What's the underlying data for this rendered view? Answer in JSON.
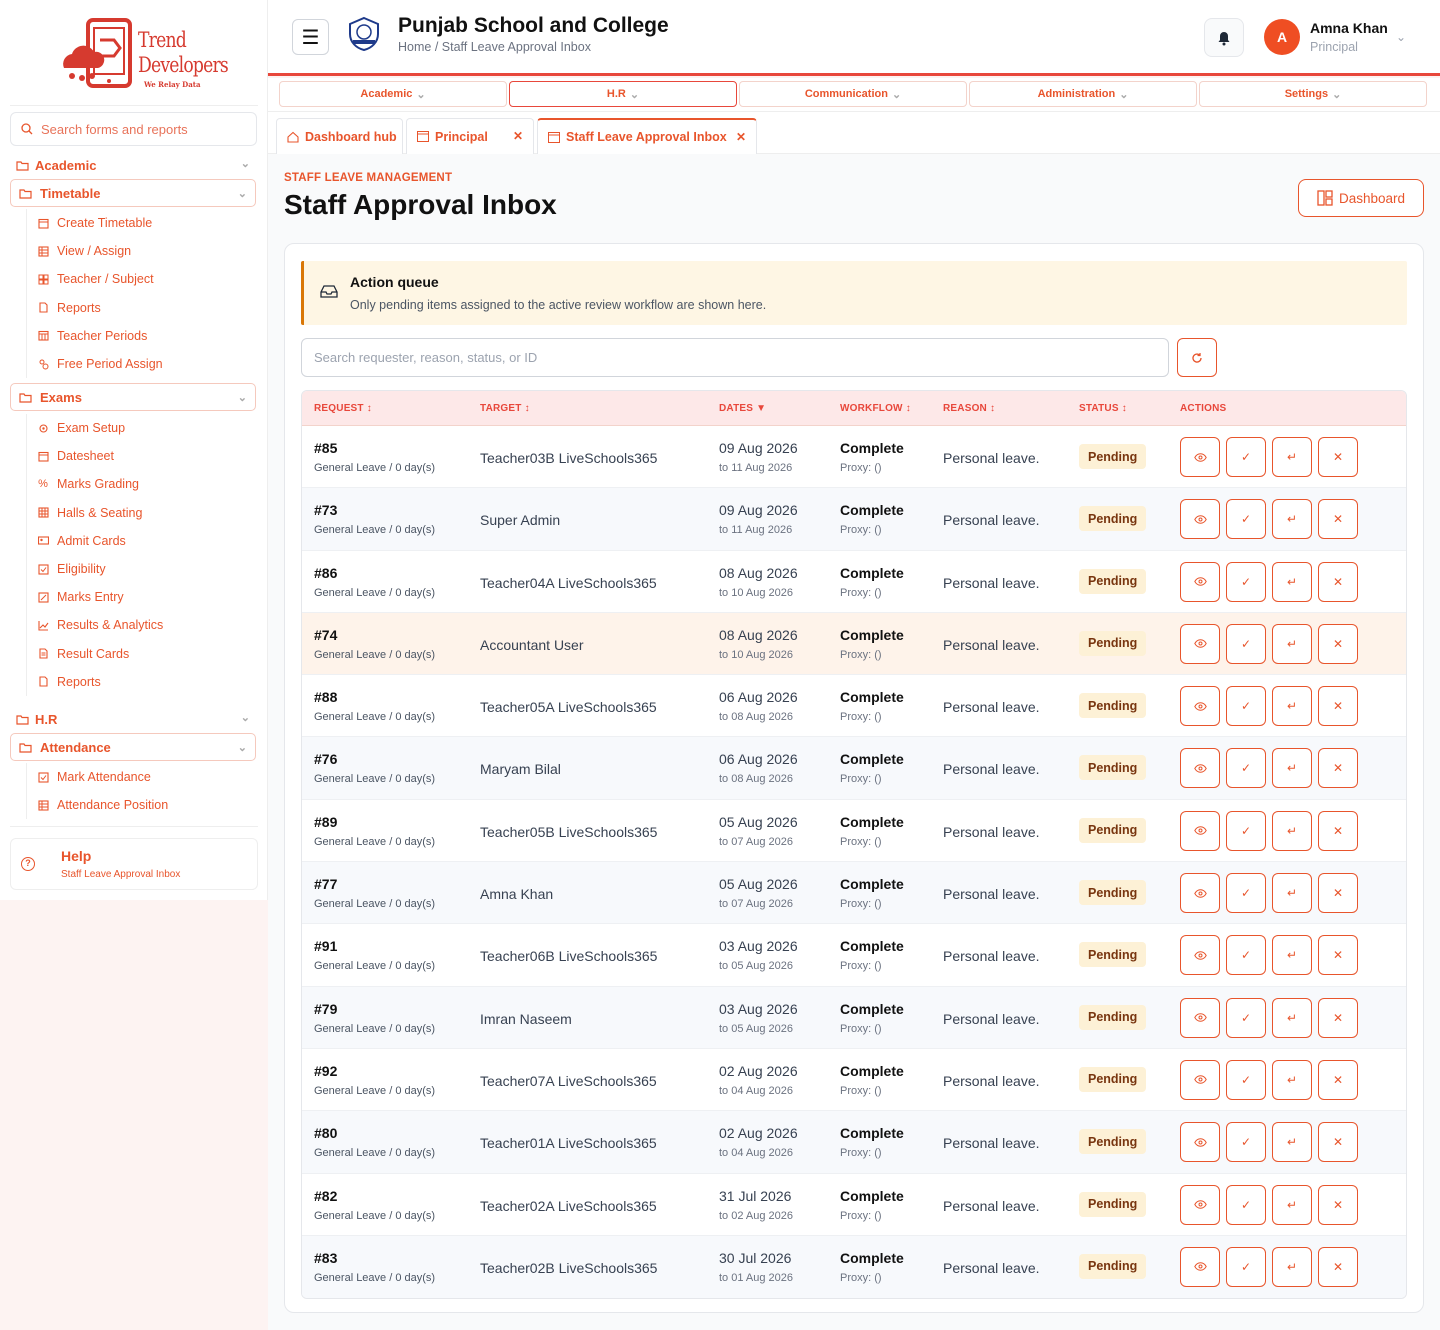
{
  "brand": {
    "line1": "Trend",
    "line2": "Developers",
    "tagline": "We Relay Data"
  },
  "sidebar": {
    "search_placeholder": "Search forms and reports",
    "academic": "Academic",
    "timetable": {
      "label": "Timetable",
      "items": [
        "Create Timetable",
        "View / Assign",
        "Teacher / Subject",
        "Reports",
        "Teacher Periods",
        "Free Period Assign"
      ]
    },
    "exams": {
      "label": "Exams",
      "items": [
        "Exam Setup",
        "Datesheet",
        "Marks Grading",
        "Halls & Seating",
        "Admit Cards",
        "Eligibility",
        "Marks Entry",
        "Results & Analytics",
        "Result Cards",
        "Reports"
      ]
    },
    "hr": "H.R",
    "attendance": {
      "label": "Attendance",
      "items": [
        "Mark Attendance",
        "Attendance Position"
      ]
    },
    "help": {
      "title": "Help",
      "subtitle": "Staff Leave Approval Inbox"
    }
  },
  "header": {
    "school_name": "Punjab School and College",
    "breadcrumb": "Home / Staff Leave Approval Inbox",
    "user": {
      "initial": "A",
      "name": "Amna Khan",
      "role": "Principal"
    }
  },
  "topnav": [
    "Academic",
    "H.R",
    "Communication",
    "Administration",
    "Settings"
  ],
  "tabs": [
    {
      "label": "Dashboard hub"
    },
    {
      "label": "Principal"
    },
    {
      "label": "Staff Leave Approval Inbox"
    }
  ],
  "main": {
    "eyebrow": "STAFF LEAVE MANAGEMENT",
    "title": "Staff Approval Inbox",
    "dashboard_label": "Dashboard",
    "alert": {
      "title": "Action queue",
      "text": "Only pending items assigned to the active review workflow are shown here."
    },
    "search_placeholder": "Search requester, reason, status, or ID"
  },
  "table": {
    "headers": {
      "request": "REQUEST",
      "target": "TARGET",
      "dates": "DATES",
      "workflow": "WORKFLOW",
      "reason": "REASON",
      "status": "STATUS",
      "actions": "ACTIONS"
    },
    "rows": [
      {
        "id": "#85",
        "type": "General Leave / 0 day(s)",
        "target": "Teacher03B LiveSchools365",
        "from": "09 Aug 2026",
        "to": "to 11 Aug 2026",
        "workflow": "Complete",
        "proxy": "Proxy: ()",
        "reason": "Personal leave.",
        "status": "Pending"
      },
      {
        "id": "#73",
        "type": "General Leave / 0 day(s)",
        "target": "Super Admin",
        "from": "09 Aug 2026",
        "to": "to 11 Aug 2026",
        "workflow": "Complete",
        "proxy": "Proxy: ()",
        "reason": "Personal leave.",
        "status": "Pending"
      },
      {
        "id": "#86",
        "type": "General Leave / 0 day(s)",
        "target": "Teacher04A LiveSchools365",
        "from": "08 Aug 2026",
        "to": "to 10 Aug 2026",
        "workflow": "Complete",
        "proxy": "Proxy: ()",
        "reason": "Personal leave.",
        "status": "Pending"
      },
      {
        "id": "#74",
        "type": "General Leave / 0 day(s)",
        "target": "Accountant User",
        "from": "08 Aug 2026",
        "to": "to 10 Aug 2026",
        "workflow": "Complete",
        "proxy": "Proxy: ()",
        "reason": "Personal leave.",
        "status": "Pending"
      },
      {
        "id": "#88",
        "type": "General Leave / 0 day(s)",
        "target": "Teacher05A LiveSchools365",
        "from": "06 Aug 2026",
        "to": "to 08 Aug 2026",
        "workflow": "Complete",
        "proxy": "Proxy: ()",
        "reason": "Personal leave.",
        "status": "Pending"
      },
      {
        "id": "#76",
        "type": "General Leave / 0 day(s)",
        "target": "Maryam Bilal",
        "from": "06 Aug 2026",
        "to": "to 08 Aug 2026",
        "workflow": "Complete",
        "proxy": "Proxy: ()",
        "reason": "Personal leave.",
        "status": "Pending"
      },
      {
        "id": "#89",
        "type": "General Leave / 0 day(s)",
        "target": "Teacher05B LiveSchools365",
        "from": "05 Aug 2026",
        "to": "to 07 Aug 2026",
        "workflow": "Complete",
        "proxy": "Proxy: ()",
        "reason": "Personal leave.",
        "status": "Pending"
      },
      {
        "id": "#77",
        "type": "General Leave / 0 day(s)",
        "target": "Amna Khan",
        "from": "05 Aug 2026",
        "to": "to 07 Aug 2026",
        "workflow": "Complete",
        "proxy": "Proxy: ()",
        "reason": "Personal leave.",
        "status": "Pending"
      },
      {
        "id": "#91",
        "type": "General Leave / 0 day(s)",
        "target": "Teacher06B LiveSchools365",
        "from": "03 Aug 2026",
        "to": "to 05 Aug 2026",
        "workflow": "Complete",
        "proxy": "Proxy: ()",
        "reason": "Personal leave.",
        "status": "Pending"
      },
      {
        "id": "#79",
        "type": "General Leave / 0 day(s)",
        "target": "Imran Naseem",
        "from": "03 Aug 2026",
        "to": "to 05 Aug 2026",
        "workflow": "Complete",
        "proxy": "Proxy: ()",
        "reason": "Personal leave.",
        "status": "Pending"
      },
      {
        "id": "#92",
        "type": "General Leave / 0 day(s)",
        "target": "Teacher07A LiveSchools365",
        "from": "02 Aug 2026",
        "to": "to 04 Aug 2026",
        "workflow": "Complete",
        "proxy": "Proxy: ()",
        "reason": "Personal leave.",
        "status": "Pending"
      },
      {
        "id": "#80",
        "type": "General Leave / 0 day(s)",
        "target": "Teacher01A LiveSchools365",
        "from": "02 Aug 2026",
        "to": "to 04 Aug 2026",
        "workflow": "Complete",
        "proxy": "Proxy: ()",
        "reason": "Personal leave.",
        "status": "Pending"
      },
      {
        "id": "#82",
        "type": "General Leave / 0 day(s)",
        "target": "Teacher02A LiveSchools365",
        "from": "31 Jul 2026",
        "to": "to 02 Aug 2026",
        "workflow": "Complete",
        "proxy": "Proxy: ()",
        "reason": "Personal leave.",
        "status": "Pending"
      },
      {
        "id": "#83",
        "type": "General Leave / 0 day(s)",
        "target": "Teacher02B LiveSchools365",
        "from": "30 Jul 2026",
        "to": "to 01 Aug 2026",
        "workflow": "Complete",
        "proxy": "Proxy: ()",
        "reason": "Personal leave.",
        "status": "Pending"
      }
    ]
  },
  "colors": {
    "accent": "#e8552c",
    "header_rule": "#e8473b",
    "pending_bg": "#fdf1d6"
  }
}
